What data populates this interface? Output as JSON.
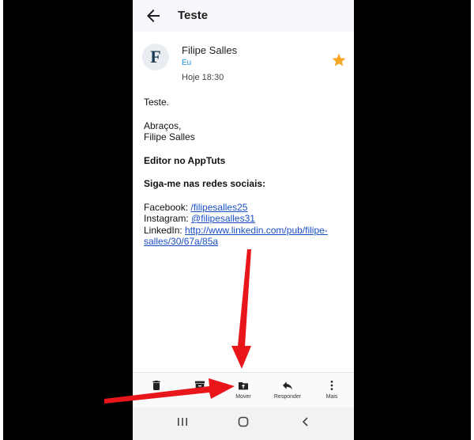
{
  "header": {
    "subject": "Teste",
    "back_icon": "back-arrow-icon"
  },
  "message": {
    "avatar_letter": "F",
    "sender": "Filipe Salles",
    "recipient": "Eu",
    "date": "Hoje 18:30",
    "starred": true,
    "star_color": "#f5a623",
    "body": {
      "greeting": "Teste.",
      "closing": "Abraços,",
      "signature_name": "Filipe Salles",
      "role": "Editor no AppTuts",
      "social_heading": "Siga-me nas redes sociais:",
      "facebook_label": "Facebook:",
      "facebook_link": "/filipesalles25",
      "instagram_label": "Instagram:",
      "instagram_link": "@filipesalles31",
      "linkedin_label": "LinkedIn:",
      "linkedin_link_line1": "http://www.linkedin.com/pub/filipe-",
      "linkedin_link_line2": "salles/30/67a/85a"
    }
  },
  "actions": [
    {
      "label": "",
      "icon": "trash-icon"
    },
    {
      "label": "",
      "icon": "archive-icon"
    },
    {
      "label": "Mover",
      "icon": "move-folder-icon"
    },
    {
      "label": "Responder",
      "icon": "reply-icon"
    },
    {
      "label": "Mais",
      "icon": "more-vert-icon"
    }
  ],
  "navbar": {
    "icons": [
      "recent-apps-icon",
      "home-icon",
      "back-nav-icon"
    ]
  },
  "annotation": {
    "arrow_color": "#e8161b"
  }
}
